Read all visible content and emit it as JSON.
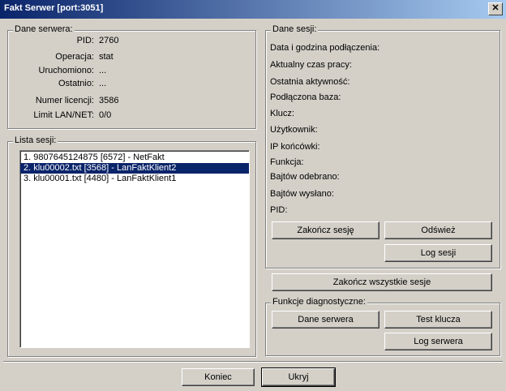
{
  "window": {
    "title": "Fakt Serwer [port:3051]",
    "close_glyph": "✕"
  },
  "server": {
    "legend": "Dane serwera:",
    "rows": [
      {
        "label": "PID:",
        "value": "2760"
      },
      {
        "label": "Operacja:",
        "value": "stat"
      },
      {
        "label": "Uruchomiono:",
        "value": "..."
      },
      {
        "label": "Ostatnio:",
        "value": "..."
      },
      {
        "label": "Numer licencji:",
        "value": "3586"
      },
      {
        "label": "Limit LAN/NET:",
        "value": "0/0"
      }
    ]
  },
  "sessions": {
    "legend": "Lista sesji:",
    "items": [
      "1. 9807645124875 [6572] - NetFakt",
      "2. klu00002.txt [3568] - LanFaktKlient2",
      "3. klu00001.txt [4480] - LanFaktKlient1"
    ],
    "selected_index": 1
  },
  "session_details": {
    "legend": "Dane sesji:",
    "fields": [
      "Data i godzina podłączenia:",
      "Aktualny czas pracy:",
      "Ostatnia aktywność:",
      "Podłączona baza:",
      "Klucz:",
      "Użytkownik:",
      "IP końcówki:",
      "Funkcja:",
      "Bajtów odebrano:",
      "Bajtów wysłano:",
      "PID:"
    ],
    "end_session": "Zakończ sesję",
    "refresh": "Odśwież",
    "session_log": "Log sesji"
  },
  "end_all_sessions": "Zakończ wszystkie sesje",
  "diagnostics": {
    "legend": "Funkcje diagnostyczne:",
    "server_data": "Dane serwera",
    "test_key": "Test klucza",
    "server_log": "Log serwera"
  },
  "footer": {
    "end": "Koniec",
    "hide": "Ukryj"
  }
}
